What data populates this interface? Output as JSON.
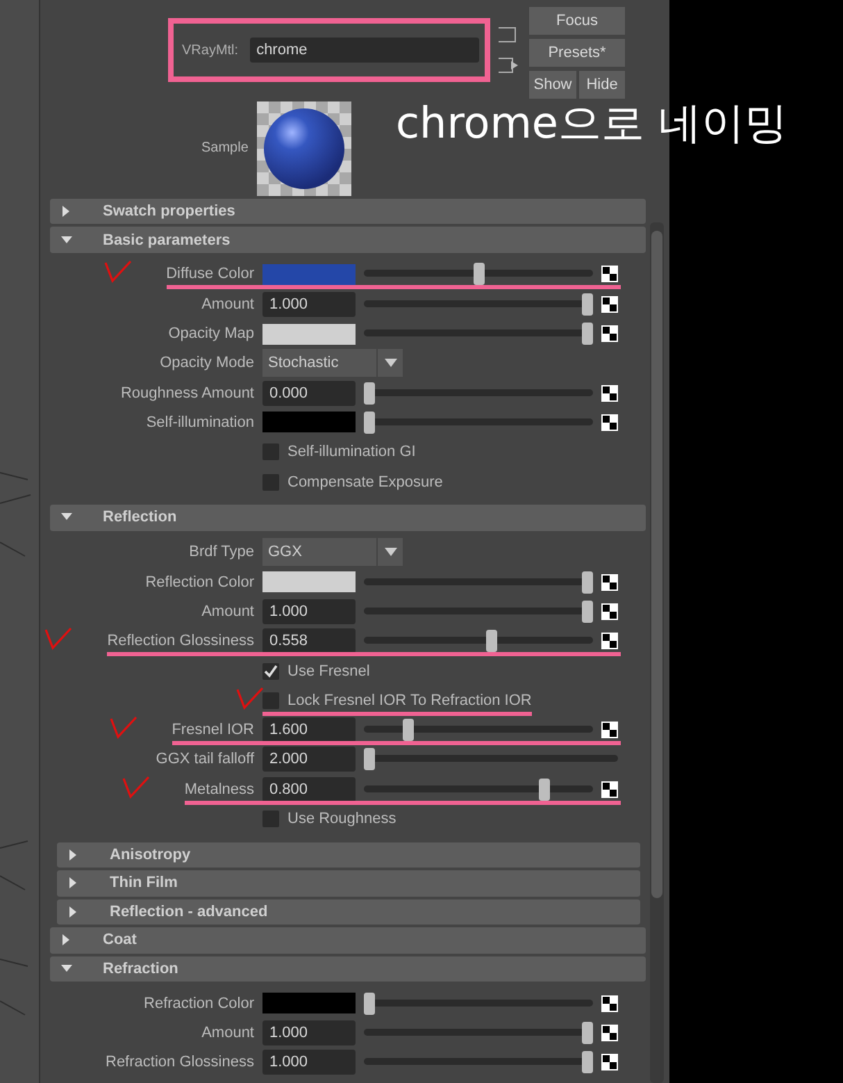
{
  "material": {
    "type_label": "VRayMtl:",
    "name": "chrome",
    "highlighted": true
  },
  "buttons": [
    "Focus",
    "Presets*",
    "Show",
    "Hide"
  ],
  "sample": {
    "label": "Sample"
  },
  "annotation": "chrome으로 네이밍",
  "sections": [
    {
      "title": "Swatch properties",
      "expanded": false
    },
    {
      "title": "Basic parameters",
      "expanded": true,
      "rows": [
        {
          "kind": "color",
          "label": "Diffuse Color",
          "color": "#2447a8",
          "level": 0.5,
          "map": true,
          "highlighted": true
        },
        {
          "kind": "number",
          "label": "Amount",
          "value": "1.000",
          "level": 1,
          "map": true,
          "highlighted": false
        },
        {
          "kind": "color",
          "label": "Opacity Map",
          "color": "#d0d0d0",
          "level": 1,
          "map": true,
          "highlighted": false
        },
        {
          "kind": "dropdown",
          "label": "Opacity Mode",
          "value": "Stochastic",
          "highlighted": false
        },
        {
          "kind": "number",
          "label": "Roughness Amount",
          "value": "0.000",
          "level": 0,
          "map": true,
          "highlighted": false
        },
        {
          "kind": "color",
          "label": "Self-illumination",
          "color": "#000000",
          "level": 0,
          "map": true,
          "highlighted": false
        },
        {
          "kind": "checkbox",
          "label": "Self-illumination GI",
          "checked": false,
          "highlighted": false
        },
        {
          "kind": "checkbox",
          "label": "Compensate Exposure",
          "checked": false,
          "highlighted": false
        }
      ]
    },
    {
      "title": "Reflection",
      "expanded": true,
      "rows": [
        {
          "kind": "dropdown",
          "label": "Brdf Type",
          "value": "GGX",
          "highlighted": false
        },
        {
          "kind": "color",
          "label": "Reflection Color",
          "color": "#d0d0d0",
          "level": 1,
          "map": true,
          "highlighted": false
        },
        {
          "kind": "number",
          "label": "Amount",
          "value": "1.000",
          "level": 1,
          "map": true,
          "highlighted": false
        },
        {
          "kind": "number",
          "label": "Reflection Glossiness",
          "value": "0.558",
          "level": 0.558,
          "map": true,
          "highlighted": true
        },
        {
          "kind": "checkbox",
          "label": "Use Fresnel",
          "checked": true,
          "highlighted": false
        },
        {
          "kind": "checkbox",
          "label": "Lock Fresnel IOR To Refraction IOR",
          "checked": false,
          "highlighted": true
        },
        {
          "kind": "number",
          "label": "Fresnel IOR",
          "value": "1.600",
          "level": 0.18,
          "map": true,
          "highlighted": true
        },
        {
          "kind": "number",
          "label": "GGX tail falloff",
          "value": "2.000",
          "level": 0,
          "map": false,
          "highlighted": false
        },
        {
          "kind": "number",
          "label": "Metalness",
          "value": "0.800",
          "level": 0.8,
          "map": true,
          "highlighted": true
        },
        {
          "kind": "checkbox",
          "label": "Use Roughness",
          "checked": false,
          "highlighted": false
        }
      ],
      "children": [
        {
          "title": "Anisotropy",
          "expanded": false
        },
        {
          "title": "Thin Film",
          "expanded": false
        },
        {
          "title": "Reflection - advanced",
          "expanded": false
        }
      ]
    },
    {
      "title": "Coat",
      "expanded": false
    },
    {
      "title": "Refraction",
      "expanded": true,
      "rows": [
        {
          "kind": "color",
          "label": "Refraction Color",
          "color": "#000000",
          "level": 0,
          "map": true,
          "highlighted": false
        },
        {
          "kind": "number",
          "label": "Amount",
          "value": "1.000",
          "level": 1,
          "map": true,
          "highlighted": false
        },
        {
          "kind": "number",
          "label": "Refraction Glossiness",
          "value": "1.000",
          "level": 1,
          "map": true,
          "highlighted": false
        }
      ]
    }
  ]
}
